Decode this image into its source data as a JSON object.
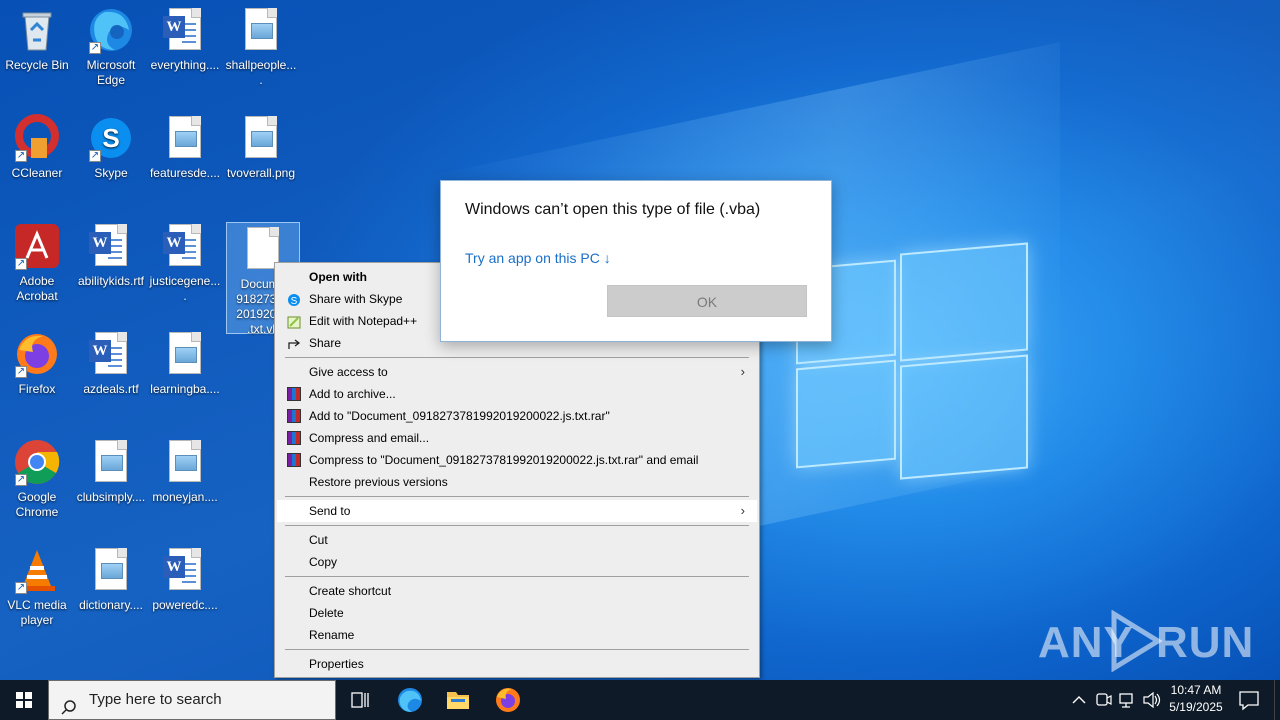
{
  "desktop": {
    "icons": [
      {
        "label": "Recycle Bin"
      },
      {
        "label": "Microsoft Edge"
      },
      {
        "label": "everything...."
      },
      {
        "label": "shallpeople...."
      },
      {
        "label": "CCleaner"
      },
      {
        "label": "Skype"
      },
      {
        "label": "featuresde...."
      },
      {
        "label": "tvoverall.png"
      },
      {
        "label": "Adobe Acrobat"
      },
      {
        "label": "abilitykids.rtf"
      },
      {
        "label": "justicegene...."
      },
      {
        "label": "Docume 91827378 20192000 .txt.vb"
      },
      {
        "label": "Firefox"
      },
      {
        "label": "azdeals.rtf"
      },
      {
        "label": "learningba...."
      },
      {
        "label": "Google Chrome"
      },
      {
        "label": "clubsimply...."
      },
      {
        "label": "moneyjan...."
      },
      {
        "label": "VLC media player"
      },
      {
        "label": "dictionary...."
      },
      {
        "label": "poweredc...."
      }
    ]
  },
  "context_menu": {
    "open_with": "Open with",
    "share_skype": "Share with Skype",
    "edit_notepad": "Edit with Notepad++",
    "share": "Share",
    "give_access": "Give access to",
    "add_archive": "Add to archive...",
    "add_to_rar": "Add to \"Document_09182737819920192000​22.js.txt.rar\"",
    "compress_email": "Compress and email...",
    "compress_to_rar_email": "Compress to \"Document_0918273781992019200022.js.txt.rar\" and email",
    "restore_versions": "Restore previous versions",
    "send_to": "Send to",
    "cut": "Cut",
    "copy": "Copy",
    "create_shortcut": "Create shortcut",
    "delete": "Delete",
    "rename": "Rename",
    "properties": "Properties"
  },
  "dialog": {
    "title": "Windows can’t open this type of file (.vba)",
    "link": "Try an app on this PC ↓",
    "ok": "OK"
  },
  "watermark": {
    "left": "ANY",
    "right": "RUN"
  },
  "taskbar": {
    "search_placeholder": "Type here to search",
    "time": "10:47 AM",
    "date": "5/19/2025"
  },
  "colors": {
    "accent": "#0078d7",
    "link": "#1a6fc9"
  }
}
